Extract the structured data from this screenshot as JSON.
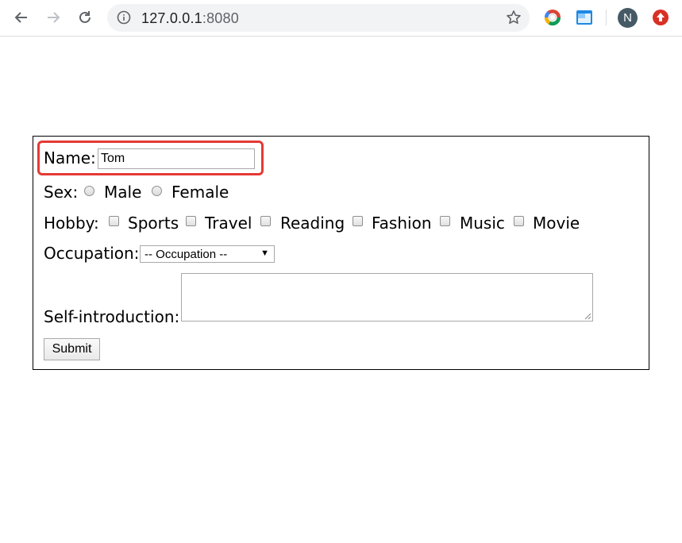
{
  "browser": {
    "url_host": "127.0.0.1",
    "url_port": ":8080",
    "profile_initial": "N"
  },
  "form": {
    "name_label": "Name:",
    "name_value": "Tom",
    "sex_label": "Sex:",
    "sex_options": [
      "Male",
      "Female"
    ],
    "hobby_label": "Hobby:",
    "hobby_options": [
      "Sports",
      "Travel",
      "Reading",
      "Fashion",
      "Music",
      "Movie"
    ],
    "occupation_label": "Occupation:",
    "occupation_selected": "-- Occupation --",
    "self_intro_label": "Self-introduction:",
    "submit_label": "Submit"
  },
  "colors": {
    "highlight": "#e53935",
    "avatar_bg": "#455a64"
  }
}
